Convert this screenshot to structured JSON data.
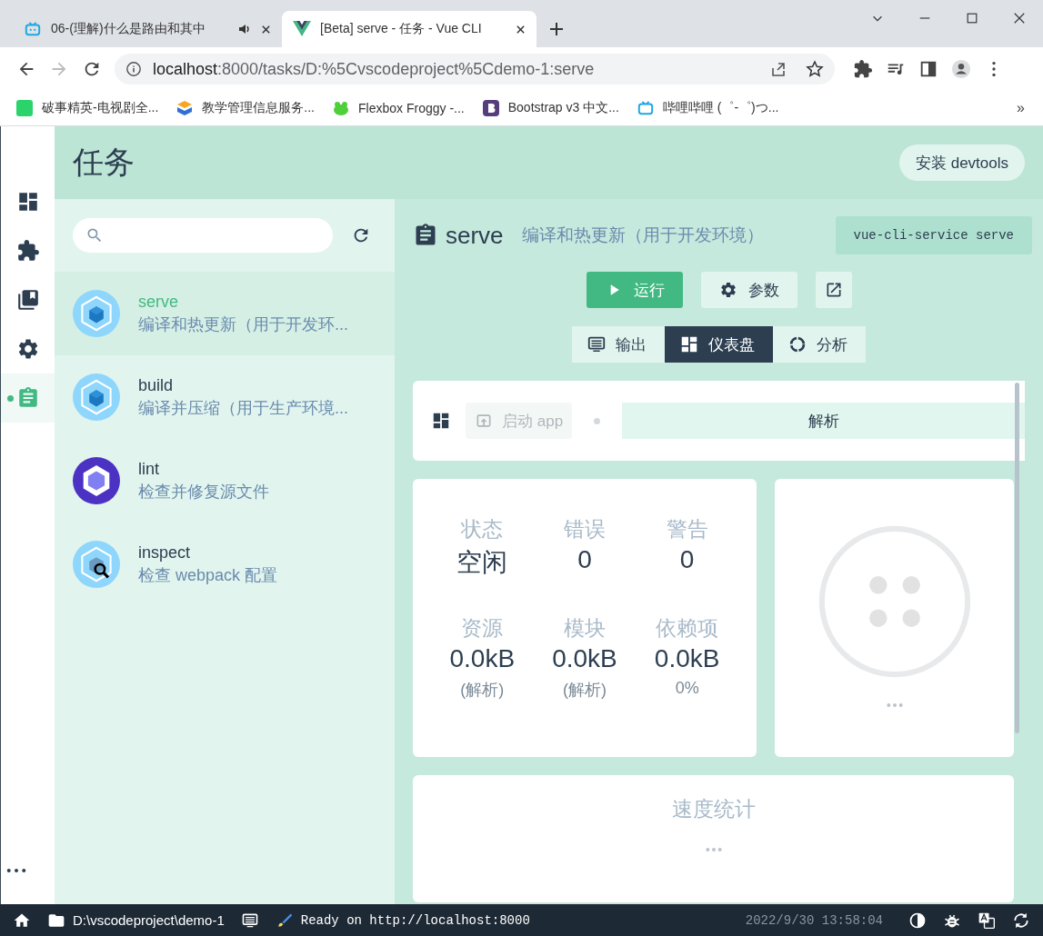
{
  "browser": {
    "tabs": [
      {
        "title": "06-(理解)什么是路由和其中",
        "kind": "bilibili",
        "audio": true,
        "selected": false
      },
      {
        "title": "[Beta] serve - 任务 - Vue CLI",
        "kind": "vue",
        "audio": false,
        "selected": true
      }
    ],
    "url": {
      "host": "localhost",
      "path": ":8000/tasks/D:%5Cvscodeproject%5Cdemo-1:serve"
    },
    "bookmarks": [
      {
        "title": "破事精英-电视剧全...",
        "kind": "iqiyi"
      },
      {
        "title": "教学管理信息服务...",
        "kind": "cube"
      },
      {
        "title": "Flexbox Froggy -...",
        "kind": "frog"
      },
      {
        "title": "Bootstrap v3 中文...",
        "kind": "bootstrap"
      },
      {
        "title": "哔哩哔哩 (゜-゜)つ...",
        "kind": "bilibili"
      }
    ],
    "bookmarks_more": "»"
  },
  "app": {
    "title": "任务",
    "devtools_button": "安装 devtools",
    "nav": [
      {
        "selected": false
      },
      {
        "selected": false
      },
      {
        "selected": false
      },
      {
        "selected": false
      },
      {
        "selected": true
      }
    ]
  },
  "tasks": [
    {
      "name": "serve",
      "description": "编译和热更新（用于开发环...",
      "kind": "webpack",
      "selected": true
    },
    {
      "name": "build",
      "description": "编译并压缩（用于生产环境...",
      "kind": "webpack",
      "selected": false
    },
    {
      "name": "lint",
      "description": "检查并修复源文件",
      "kind": "eslint",
      "selected": false
    },
    {
      "name": "inspect",
      "description": "检查 webpack 配置",
      "kind": "inspect",
      "selected": false
    }
  ],
  "detail": {
    "name": "serve",
    "description": "编译和热更新（用于开发环境）",
    "command": "vue-cli-service serve",
    "run_button": "运行",
    "params_button": "参数",
    "views": [
      {
        "label": "输出",
        "selected": false
      },
      {
        "label": "仪表盘",
        "selected": true
      },
      {
        "label": "分析",
        "selected": false
      }
    ]
  },
  "dashboard": {
    "launch_button": {
      "label": "启动 app",
      "disabled": true
    },
    "analyze_label": "解析",
    "stats": [
      {
        "label": "状态",
        "value": "空闲"
      },
      {
        "label": "错误",
        "value": "0"
      },
      {
        "label": "警告",
        "value": "0"
      },
      {
        "label": "资源",
        "value": "0.0kB",
        "note": "(解析)"
      },
      {
        "label": "模块",
        "value": "0.0kB",
        "note": "(解析)"
      },
      {
        "label": "依赖项",
        "value": "0.0kB",
        "note": "0%"
      }
    ],
    "speed_title": "速度统计"
  },
  "status_bar": {
    "folder": "D:\\vscodeproject\\demo-1",
    "message": "Ready on http://localhost:8000",
    "time": "2022/9/30 13:58:04"
  }
}
